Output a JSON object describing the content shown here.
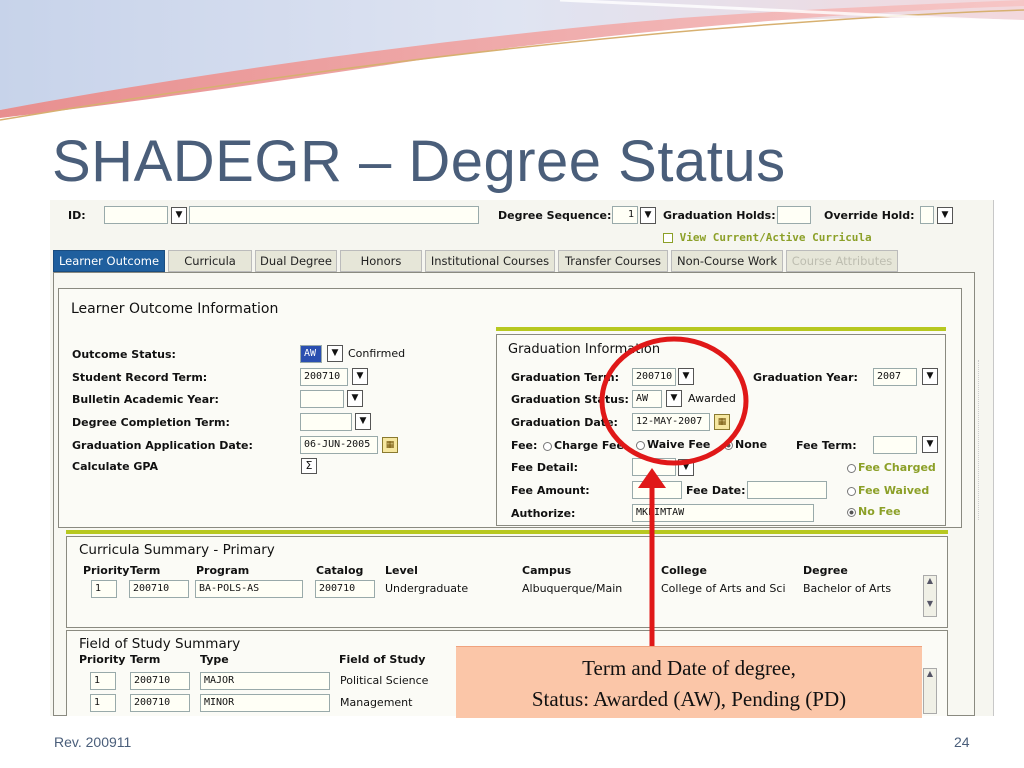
{
  "slide": {
    "title": "SHADEGR – Degree Status",
    "footer_rev": "Rev. 200911",
    "page_number": "24",
    "callout_line1": "Term and Date of degree,",
    "callout_line2": "Status: Awarded (AW), Pending (PD)"
  },
  "key_block": {
    "id_label": "ID:",
    "id_value": "",
    "name_value": "",
    "degree_sequence_label": "Degree Sequence:",
    "degree_sequence_value": "1",
    "graduation_holds_label": "Graduation Holds:",
    "graduation_holds_value": "",
    "override_hold_label": "Override Hold:",
    "override_hold_value": "",
    "view_curricula_label": "View Current/Active Curricula"
  },
  "tabs": [
    {
      "label": "Learner Outcome"
    },
    {
      "label": "Curricula"
    },
    {
      "label": "Dual Degree"
    },
    {
      "label": "Honors"
    },
    {
      "label": "Institutional Courses"
    },
    {
      "label": "Transfer Courses"
    },
    {
      "label": "Non-Course Work"
    },
    {
      "label": "Course Attributes"
    }
  ],
  "learner_outcome": {
    "title": "Learner Outcome Information",
    "outcome_status_label": "Outcome Status:",
    "outcome_status_value": "AW",
    "outcome_status_desc": "Confirmed",
    "student_record_term_label": "Student Record Term:",
    "student_record_term_value": "200710",
    "bulletin_year_label": "Bulletin Academic Year:",
    "bulletin_year_value": "",
    "degree_completion_term_label": "Degree Completion Term:",
    "degree_completion_term_value": "",
    "grad_app_date_label": "Graduation Application Date:",
    "grad_app_date_value": "06-JUN-2005",
    "calculate_gpa_label": "Calculate GPA",
    "calculate_gpa_symbol": "Σ"
  },
  "graduation": {
    "title": "Graduation Information",
    "term_label": "Graduation Term:",
    "term_value": "200710",
    "year_label": "Graduation Year:",
    "year_value": "2007",
    "status_label": "Graduation Status:",
    "status_value": "AW",
    "status_desc": "Awarded",
    "date_label": "Graduation Date:",
    "date_value": "12-MAY-2007",
    "fee_label": "Fee:",
    "fee_charge": "Charge Fee",
    "fee_waive": "Waive Fee",
    "fee_none": "None",
    "fee_term_label": "Fee Term:",
    "fee_term_value": "",
    "fee_detail_label": "Fee Detail:",
    "fee_detail_value": "",
    "fee_amount_label": "Fee Amount:",
    "fee_amount_value": "",
    "fee_date_label": "Fee Date:",
    "fee_date_value": "",
    "authorize_label": "Authorize:",
    "authorize_value": "MKLIMTAW",
    "fee_charged": "Fee Charged",
    "fee_waived": "Fee Waived",
    "no_fee": "No Fee"
  },
  "curricula_summary": {
    "title": "Curricula Summary - Primary",
    "headers": [
      "Priority",
      "Term",
      "Program",
      "Catalog",
      "Level",
      "Campus",
      "College",
      "Degree"
    ],
    "row": [
      "1",
      "200710",
      "BA-POLS-AS",
      "200710",
      "Undergraduate",
      "Albuquerque/Main",
      "College of Arts and Sci",
      "Bachelor of Arts"
    ]
  },
  "field_of_study": {
    "title": "Field of Study Summary",
    "headers": [
      "Priority",
      "Term",
      "Type",
      "Field of Study"
    ],
    "rows": [
      [
        "1",
        "200710",
        "MAJOR",
        "Political Science"
      ],
      [
        "1",
        "200710",
        "MINOR",
        "Management"
      ]
    ]
  },
  "icons": {
    "dropdown": "▼",
    "calendar": "▦",
    "scroll_up": "▲",
    "scroll_down": "▼"
  },
  "colors": {
    "title": "#4a5e7a",
    "active_tab": "#1f5f9e",
    "highlight_circle": "#e01818",
    "arrow": "#e01818",
    "callout_bg": "#fbc6a8",
    "olive_bar": "#b7c820"
  }
}
